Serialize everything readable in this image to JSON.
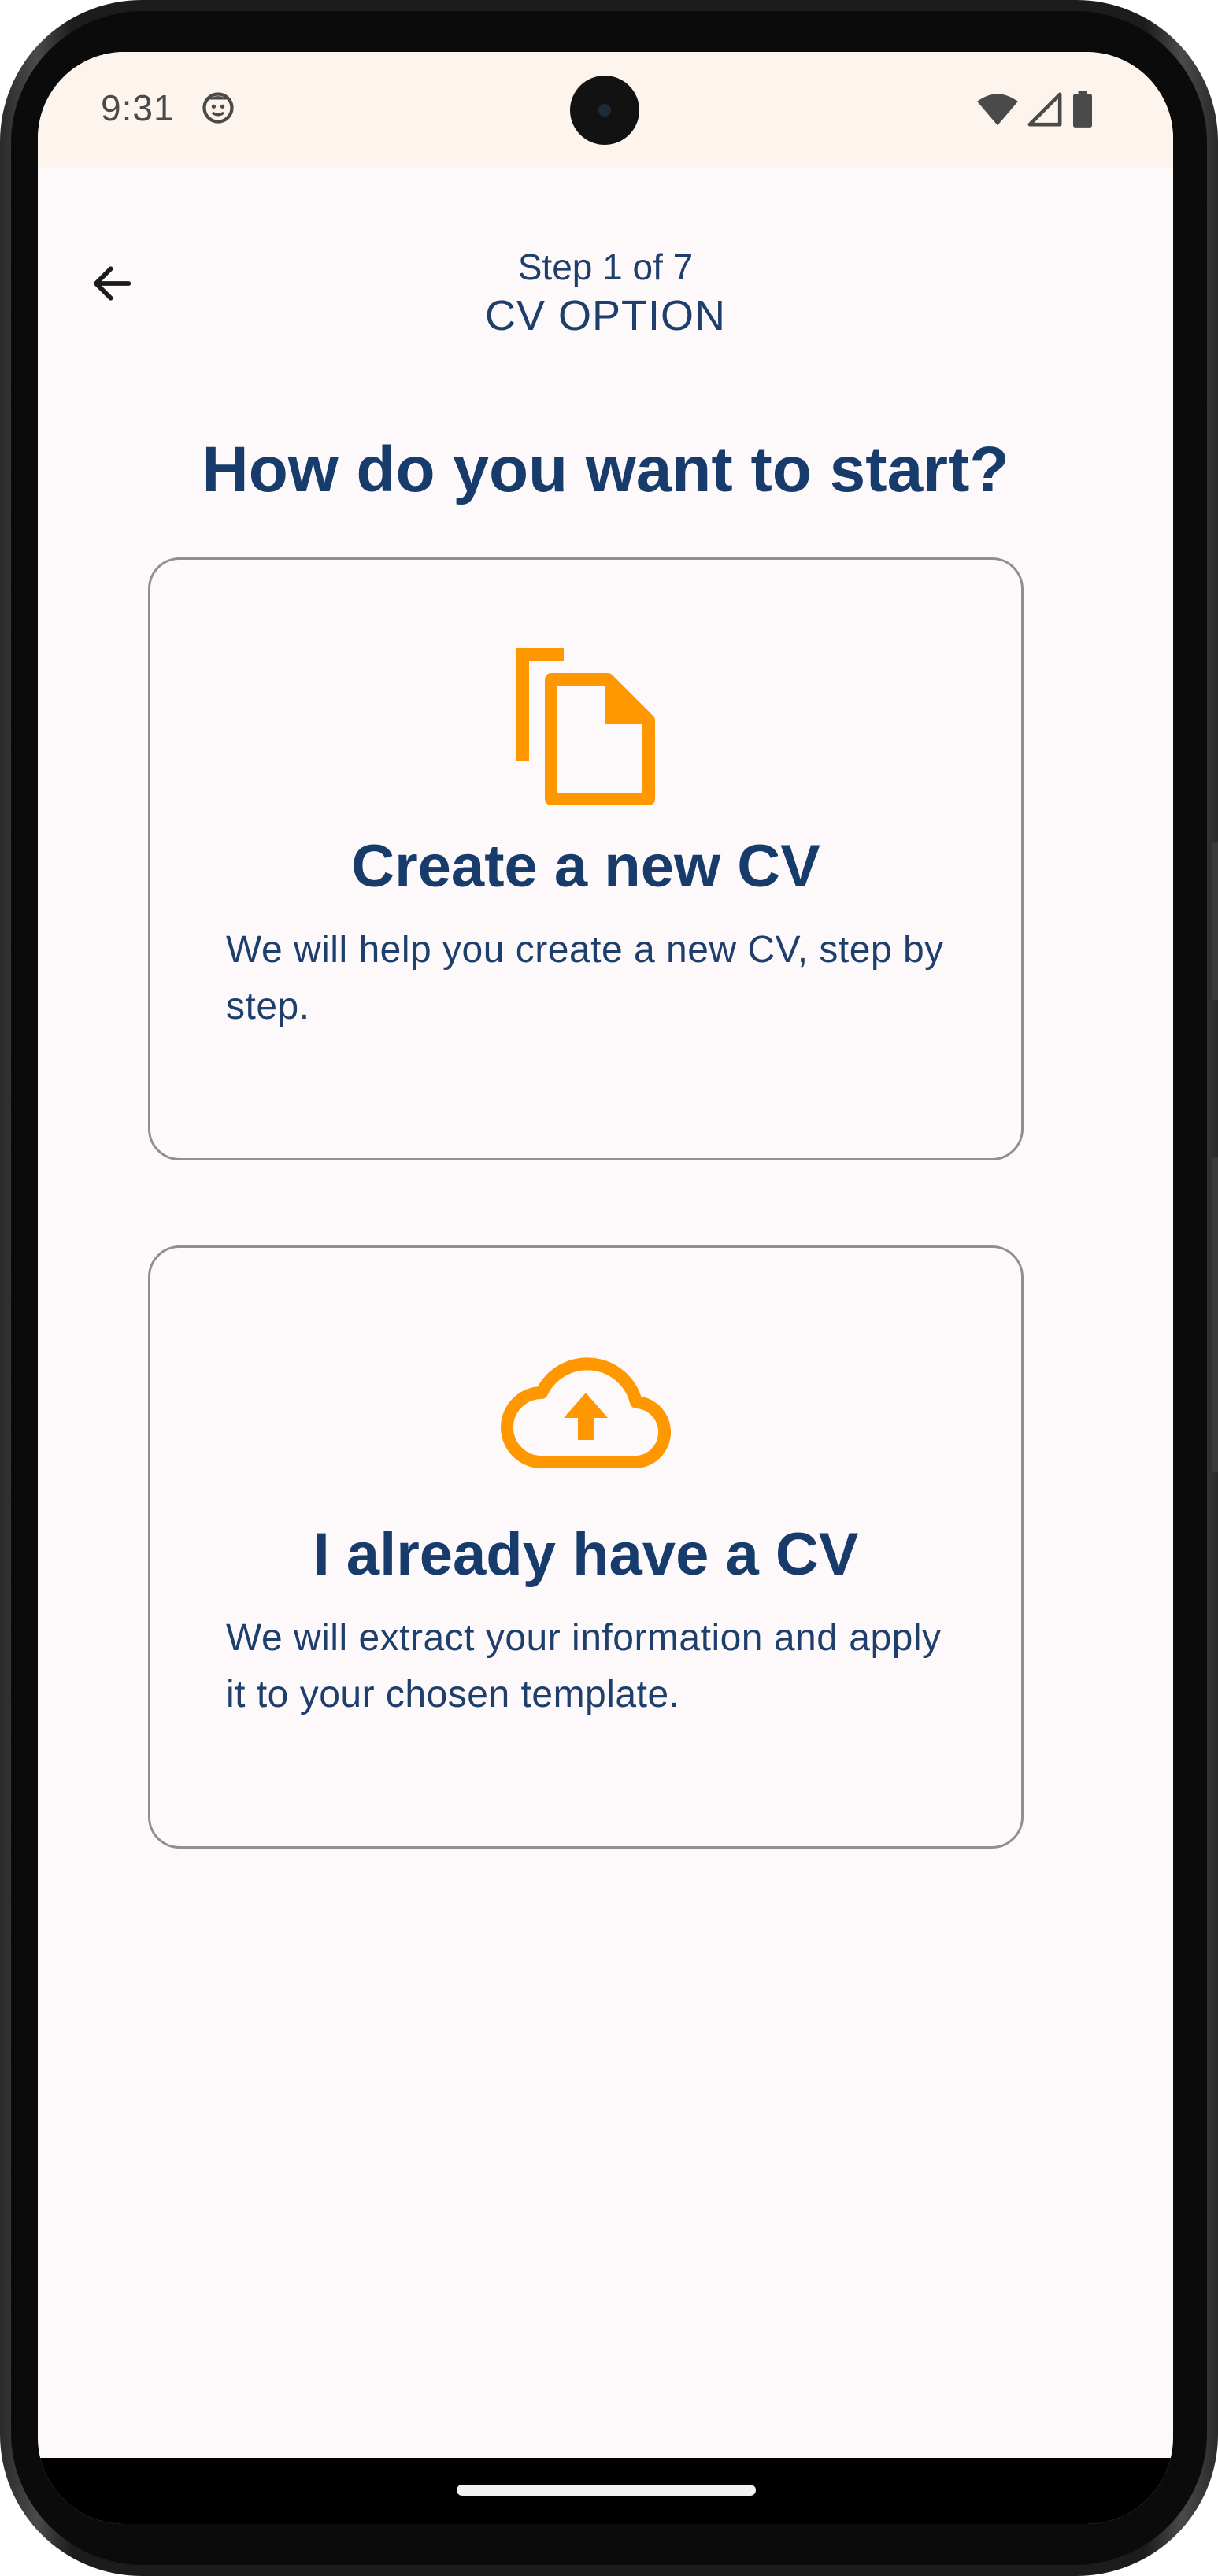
{
  "status_bar": {
    "time": "9:31",
    "icons": [
      "face-notification-icon",
      "wifi-icon",
      "cell-signal-icon",
      "battery-icon"
    ]
  },
  "app_bar": {
    "back_icon": "arrow-back-icon",
    "step": "Step 1 of 7",
    "title": "CV OPTION"
  },
  "main": {
    "heading": "How do you want to start?",
    "options": [
      {
        "icon": "copy-file-icon",
        "title": "Create a new CV",
        "description": "We will help you create a new CV, step by step."
      },
      {
        "icon": "cloud-upload-icon",
        "title": "I already have a CV",
        "description": "We will extract your information and apply it to your chosen template."
      }
    ]
  },
  "colors": {
    "accent_orange": "#FF9800",
    "primary_navy": "#173C6B",
    "app_bar_bg": "#FDF5ED",
    "screen_bg": "#FDF9FB",
    "card_border": "#8F8F8F"
  }
}
